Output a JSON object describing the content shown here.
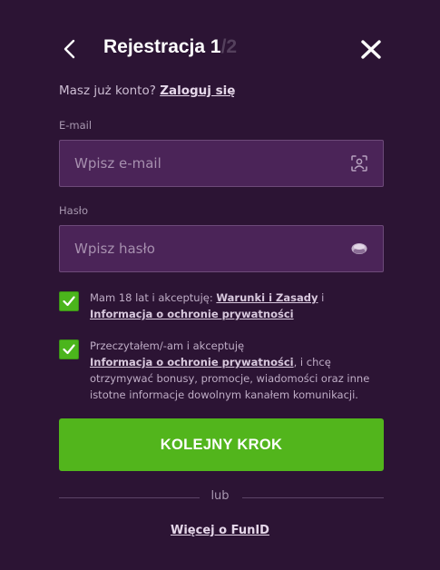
{
  "header": {
    "title": "Rejestracja 1",
    "step_total": "/2"
  },
  "account": {
    "prompt": "Masz już konto?",
    "login_link": "Zaloguj się"
  },
  "email": {
    "label": "E-mail",
    "placeholder": "Wpisz e-mail",
    "value": ""
  },
  "password": {
    "label": "Hasło",
    "placeholder": "Wpisz hasło",
    "value": ""
  },
  "consents": [
    {
      "checked": true,
      "text_before": "Mam 18 lat i akceptuję: ",
      "link1": "Warunki i Zasady",
      "text_middle": " i ",
      "link2": "Informacja o ochronie prywatności"
    },
    {
      "checked": true,
      "text_before": "Przeczytałem/-am i akceptuję ",
      "link1": "Informacja o ochronie prywatności",
      "text_after": ", i chcę otrzymywać bonusy, promocje, wiadomości oraz inne istotne informacje dowolnym kanałem komunikacji."
    }
  ],
  "next_button": "KOLEJNY KROK",
  "divider": "lub",
  "more_link": "Więcej o FunID",
  "colors": {
    "background": "#2c1434",
    "field_background": "#4b2458",
    "accent_green": "#52b51c"
  }
}
